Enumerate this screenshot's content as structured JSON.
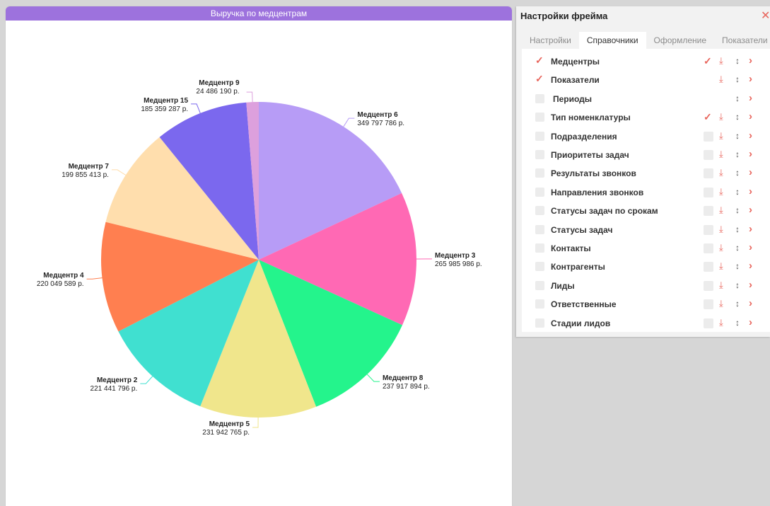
{
  "chart_data": {
    "type": "pie",
    "title": "Выручка по медцентрам",
    "value_suffix": " р.",
    "slices": [
      {
        "label": "Медцентр 6",
        "value": 349797786,
        "value_text": "349 797 786 р.",
        "color": "#b79cf6"
      },
      {
        "label": "Медцентр 3",
        "value": 265985986,
        "value_text": "265 985 986 р.",
        "color": "#ff69b4"
      },
      {
        "label": "Медцентр 8",
        "value": 237917894,
        "value_text": "237 917 894 р.",
        "color": "#24f48c"
      },
      {
        "label": "Медцентр 5",
        "value": 231942765,
        "value_text": "231 942 765 р.",
        "color": "#f0e68c"
      },
      {
        "label": "Медцентр 2",
        "value": 221441796,
        "value_text": "221 441 796 р.",
        "color": "#40e0d0"
      },
      {
        "label": "Медцентр 4",
        "value": 220049589,
        "value_text": "220 049 589 р.",
        "color": "#ff7f50"
      },
      {
        "label": "Медцентр 7",
        "value": 199855413,
        "value_text": "199 855 413 р.",
        "color": "#ffdead"
      },
      {
        "label": "Медцентр 15",
        "value": 185359287,
        "value_text": "185 359 287 р.",
        "color": "#7b68ee"
      },
      {
        "label": "Медцентр 9",
        "value": 24486190,
        "value_text": "24 486 190 р.",
        "color": "#dda0dd"
      }
    ]
  },
  "settings": {
    "title": "Настройки фрейма",
    "close_icon": "close-icon",
    "tabs": [
      {
        "label": "Настройки",
        "active": false
      },
      {
        "label": "Справочники",
        "active": true
      },
      {
        "label": "Оформление",
        "active": false
      },
      {
        "label": "Показатели",
        "active": false
      }
    ],
    "items": [
      {
        "label": "Медцентры",
        "checked": true,
        "action_checked": true,
        "has_download": true
      },
      {
        "label": "Показатели",
        "checked": true,
        "action_checked": null,
        "has_download": true
      },
      {
        "label": "Периоды",
        "checked": false,
        "action_checked": null,
        "has_download": false
      },
      {
        "label": "Тип номенклатуры",
        "checked": false,
        "action_checked": true,
        "has_download": true
      },
      {
        "label": "Подразделения",
        "checked": false,
        "action_checked": false,
        "has_download": true
      },
      {
        "label": "Приоритеты задач",
        "checked": false,
        "action_checked": false,
        "has_download": true
      },
      {
        "label": "Результаты звонков",
        "checked": false,
        "action_checked": false,
        "has_download": true
      },
      {
        "label": "Направления звонков",
        "checked": false,
        "action_checked": false,
        "has_download": true
      },
      {
        "label": "Статусы задач по срокам",
        "checked": false,
        "action_checked": false,
        "has_download": true
      },
      {
        "label": "Статусы задач",
        "checked": false,
        "action_checked": false,
        "has_download": true
      },
      {
        "label": "Контакты",
        "checked": false,
        "action_checked": false,
        "has_download": true
      },
      {
        "label": "Контрагенты",
        "checked": false,
        "action_checked": false,
        "has_download": true
      },
      {
        "label": "Лиды",
        "checked": false,
        "action_checked": false,
        "has_download": true
      },
      {
        "label": "Ответственные",
        "checked": false,
        "action_checked": false,
        "has_download": true
      },
      {
        "label": "Стадии лидов",
        "checked": false,
        "action_checked": false,
        "has_download": true
      }
    ]
  }
}
